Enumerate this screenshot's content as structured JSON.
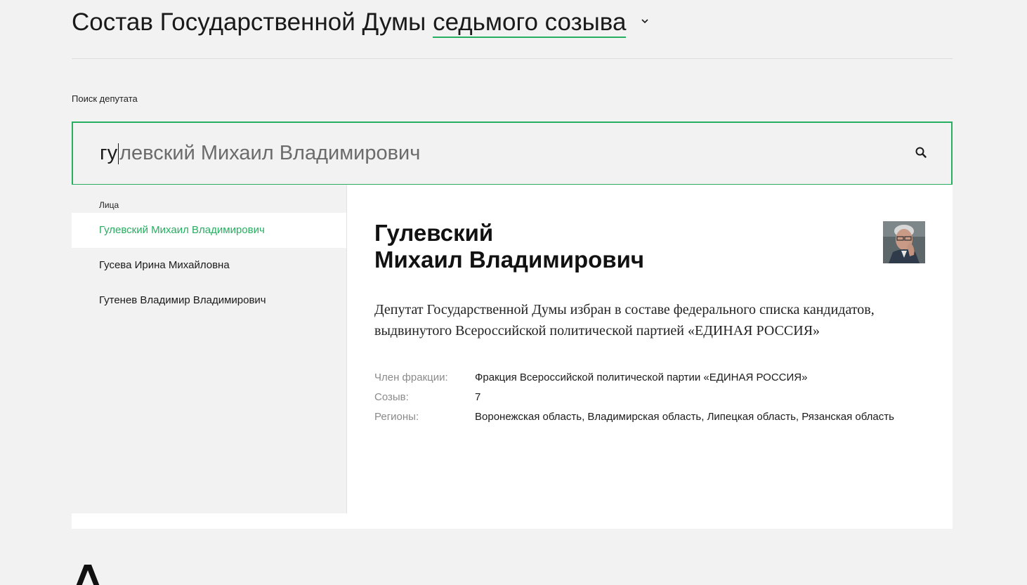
{
  "header": {
    "title_prefix": "Состав Государственной Думы",
    "convocation": "седьмого созыва",
    "convocation_icon": "chevron-down-icon"
  },
  "search": {
    "label": "Поиск депутата",
    "typed_text": "гу",
    "suggestion_text": "левский Михаил Владимирович",
    "button_icon": "search-icon"
  },
  "results": {
    "group_label": "Лица",
    "items": [
      {
        "label": "Гулевский Михаил Владимирович",
        "active": true
      },
      {
        "label": "Гусева Ирина Михайловна",
        "active": false
      },
      {
        "label": "Гутенев Владимир Владимирович",
        "active": false
      }
    ]
  },
  "detail": {
    "surname": "Гулевский",
    "given_names": "Михаил Владимирович",
    "photo_icon": "deputy-portrait",
    "description": "Депутат Государственной Думы избран в составе федерального списка кандидатов, выдвинутого Всероссийской политической партией «ЕДИНАЯ РОССИЯ»",
    "faction_label": "Член фракции:",
    "faction_value": "Фракция Всероссийской политической партии «ЕДИНАЯ РОССИЯ»",
    "convocation_label": "Созыв:",
    "convocation_value": "7",
    "regions_label": "Регионы:",
    "regions_value": "Воронежская область, Владимирская область, Липецкая область, Рязанская область"
  },
  "footer": {
    "logo_icon": "logo-letter-icon"
  },
  "colors": {
    "accent": "#27ae60",
    "background": "#f2f2f2",
    "panel": "#ffffff"
  }
}
